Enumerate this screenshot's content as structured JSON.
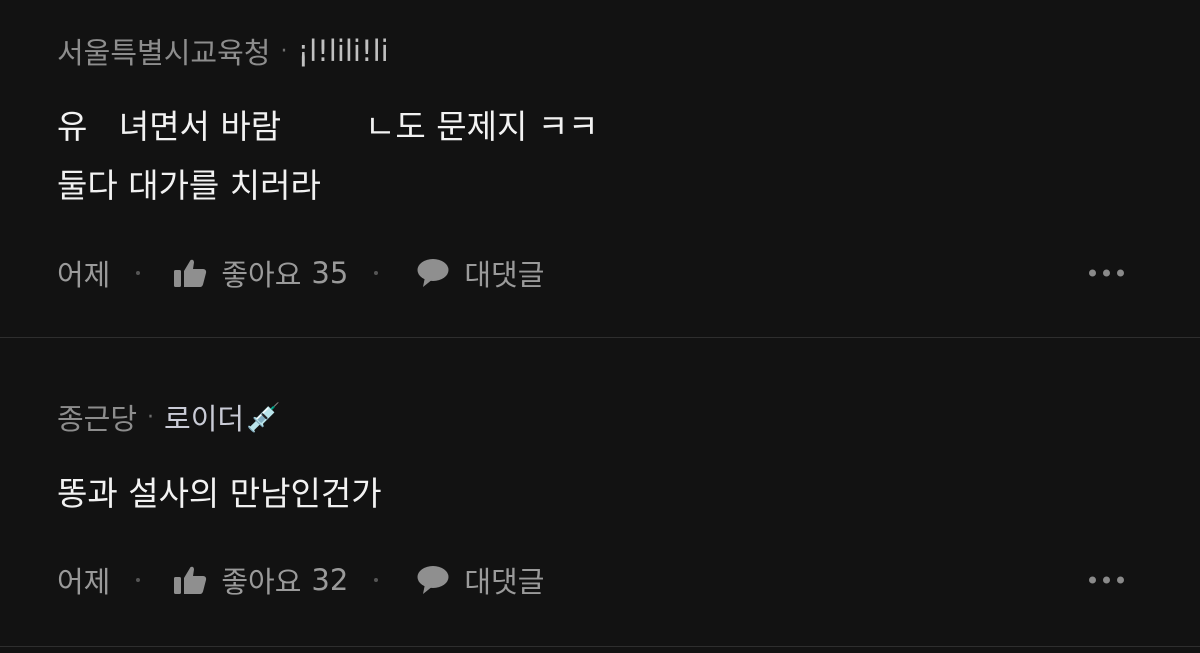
{
  "comments": [
    {
      "author": "서울특별시교육청",
      "badge_sep": "·",
      "badge_text": "¡l!lili!li",
      "lines": [
        "유   녀면서 바람        ㄴ도 문제지 ㅋㅋ",
        "둘다 대가를 치러라"
      ],
      "time": "어제",
      "like_label": "좋아요",
      "like_count": "35",
      "reply_label": "대댓글"
    },
    {
      "author": "종근당",
      "badge_sep": "·",
      "badge_text": "로이더",
      "badge_emoji": "💉",
      "lines": [
        "똥과 설사의 만남인건가"
      ],
      "time": "어제",
      "like_label": "좋아요",
      "like_count": "32",
      "reply_label": "대댓글"
    }
  ],
  "icons": {
    "like": "thumbs-up-icon",
    "reply": "speech-bubble-icon",
    "more": "more-horizontal-icon"
  },
  "colors": {
    "background": "#121212",
    "divider": "#2e2e2e",
    "meta_text": "#8d8d8d",
    "body_text": "#f2f2f2"
  }
}
